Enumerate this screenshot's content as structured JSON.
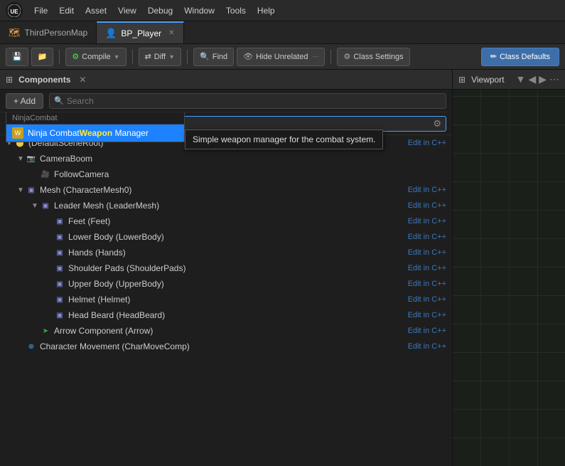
{
  "menuBar": {
    "logo": "UE",
    "items": [
      "File",
      "Edit",
      "Asset",
      "View",
      "Debug",
      "Window",
      "Tools",
      "Help"
    ]
  },
  "tabs": [
    {
      "id": "third-person-map",
      "icon": "🗺",
      "label": "ThirdPersonMap",
      "active": false
    },
    {
      "id": "bp-player",
      "icon": "👤",
      "label": "BP_Player",
      "active": true,
      "closable": true
    }
  ],
  "toolbar": {
    "save_label": "💾",
    "browse_label": "📁",
    "compile_label": "Compile",
    "compile_icon": "⚙",
    "diff_label": "Diff",
    "diff_icon": "⇄",
    "find_label": "Find",
    "find_icon": "🔍",
    "hide_unrelated_label": "Hide Unrelated",
    "hide_unrelated_icon": "👁",
    "class_settings_label": "Class Settings",
    "class_settings_icon": "⚙",
    "class_defaults_label": "Class Defaults",
    "class_defaults_icon": "✏"
  },
  "componentsPanel": {
    "title": "Components",
    "add_label": "+ Add",
    "search_placeholder": "Search"
  },
  "searchBox": {
    "clear_icon": "✕",
    "value": "weapon",
    "settings_icon": "⚙"
  },
  "dropdown": {
    "category": "NinjaCombat",
    "item": {
      "icon": "W",
      "label_before": "Ninja Combat",
      "label_highlight": "Weapon",
      "label_after": " Manager"
    }
  },
  "tooltip": {
    "text": "Simple weapon manager for the combat system."
  },
  "componentList": [
    {
      "id": "default-scene",
      "indent": 0,
      "type": "scene",
      "label": "(DefaultSceneRoot)",
      "editable": true,
      "expanded": true
    },
    {
      "id": "camera-boom",
      "indent": 1,
      "type": "camera",
      "label": "CameraBoom",
      "editable": false,
      "expanded": true
    },
    {
      "id": "follow-camera",
      "indent": 2,
      "type": "camera",
      "label": "FollowCamera",
      "editable": false,
      "expanded": false
    },
    {
      "id": "mesh",
      "indent": 1,
      "type": "mesh",
      "label": "Mesh (CharacterMesh0)",
      "editable": true,
      "expanded": true
    },
    {
      "id": "leader-mesh",
      "indent": 2,
      "type": "mesh",
      "label": "Leader Mesh (LeaderMesh)",
      "editable": true,
      "expanded": true
    },
    {
      "id": "feet",
      "indent": 3,
      "type": "mesh",
      "label": "Feet (Feet)",
      "editable": true
    },
    {
      "id": "lower-body",
      "indent": 3,
      "type": "mesh",
      "label": "Lower Body (LowerBody)",
      "editable": true
    },
    {
      "id": "hands",
      "indent": 3,
      "type": "mesh",
      "label": "Hands (Hands)",
      "editable": true
    },
    {
      "id": "shoulder-pads",
      "indent": 3,
      "type": "mesh",
      "label": "Shoulder Pads (ShoulderPads)",
      "editable": true
    },
    {
      "id": "upper-body",
      "indent": 3,
      "type": "mesh",
      "label": "Upper Body (UpperBody)",
      "editable": true
    },
    {
      "id": "helmet",
      "indent": 3,
      "type": "mesh",
      "label": "Helmet (Helmet)",
      "editable": true
    },
    {
      "id": "head-beard",
      "indent": 3,
      "type": "mesh",
      "label": "Head Beard (HeadBeard)",
      "editable": true
    },
    {
      "id": "arrow",
      "indent": 2,
      "type": "arrow",
      "label": "Arrow Component (Arrow)",
      "editable": true
    },
    {
      "id": "character-movement",
      "indent": 1,
      "type": "move",
      "label": "Character Movement (CharMoveComp)",
      "editable": true
    }
  ],
  "editCppLabel": "Edit in C++",
  "viewportPanel": {
    "title": "Viewport",
    "nav_icon_back": "◀",
    "nav_icon_forward": "▶",
    "nav_icon_dropdown": "▼",
    "nav_icon_more": "⋯"
  }
}
